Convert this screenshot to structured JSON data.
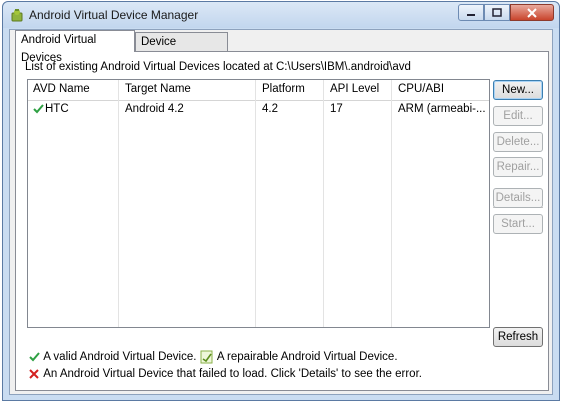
{
  "window": {
    "title": "Android Virtual Device Manager",
    "icon": "android-app-icon",
    "controls": [
      "minimize",
      "maximize",
      "close"
    ]
  },
  "tabs": [
    {
      "label": "Android Virtual Devices",
      "active": true
    },
    {
      "label": "Device Definitions",
      "active": false
    }
  ],
  "list_label": "List of existing Android Virtual Devices located at C:\\Users\\IBM\\.android\\avd",
  "table": {
    "columns": [
      "AVD Name",
      "Target Name",
      "Platform",
      "API Level",
      "CPU/ABI"
    ],
    "rows": [
      {
        "status": "valid",
        "avd_name": "HTC",
        "target_name": "Android 4.2",
        "platform": "4.2",
        "api_level": "17",
        "cpu_abi": "ARM (armeabi-..."
      }
    ]
  },
  "buttons": {
    "new": "New...",
    "edit": "Edit...",
    "delete": "Delete...",
    "repair": "Repair...",
    "details": "Details...",
    "start": "Start...",
    "refresh": "Refresh"
  },
  "legend": {
    "valid": "A valid Android Virtual Device.",
    "repairable": "A repairable Android Virtual Device.",
    "failed": "An Android Virtual Device that failed to load. Click 'Details' to see the error."
  },
  "colors": {
    "valid_check": "#2ea043",
    "failed_x": "#d42020",
    "selection_border": "#3c7fb1"
  }
}
